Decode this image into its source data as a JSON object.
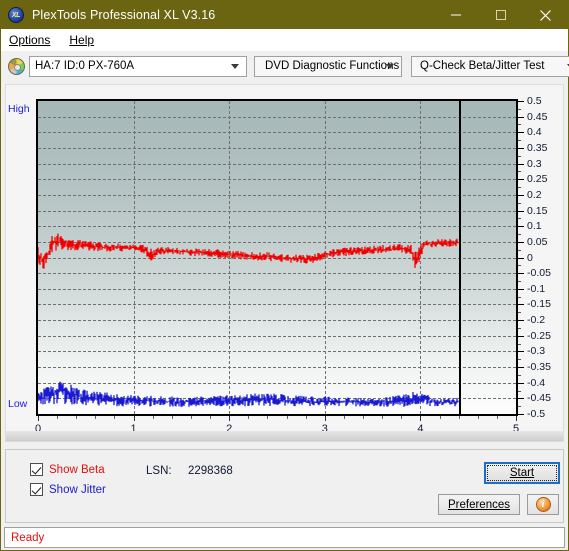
{
  "window": {
    "title": "PlexTools Professional XL V3.16",
    "icon": "xl-disc-icon",
    "icon_text": "XL",
    "minimize_label": "–",
    "maximize_label": "□",
    "close_label": "✕"
  },
  "menubar": {
    "items": [
      {
        "label": "Options",
        "mnemonic": "O"
      },
      {
        "label": "Help",
        "mnemonic": "H"
      }
    ]
  },
  "toolbar": {
    "drive_icon": "disc-icon",
    "drive_select": "HA:7 ID:0  PX-760A",
    "function_select": "DVD Diagnostic Functions",
    "test_select": "Q-Check Beta/Jitter Test"
  },
  "chart_panel": {
    "high_label": "High",
    "low_label": "Low"
  },
  "controls": {
    "show_beta_label": "Show Beta",
    "show_beta_mnemonic": "B",
    "show_beta_checked": true,
    "show_jitter_label": "Show Jitter",
    "show_jitter_mnemonic": "J",
    "show_jitter_checked": true,
    "lsn_label": "LSN:",
    "lsn_value": "2298368",
    "start_label": "Start",
    "start_mnemonic": "S",
    "preferences_label": "Preferences",
    "preferences_mnemonic": "P",
    "info_label": "i"
  },
  "statusbar": {
    "text": "Ready"
  },
  "colors": {
    "titlebar": "#6b6410",
    "beta_trace": "#f00000",
    "jitter_trace": "#1a1ad0",
    "axis_text": "#111a33",
    "status_text": "#e01010",
    "accent_focus": "#1e6ec8"
  },
  "chart_data": {
    "type": "line",
    "title": "Q-Check Beta/Jitter Test",
    "xlabel": "",
    "ylabel": "",
    "xlim": [
      0,
      5
    ],
    "ylim": [
      -0.5,
      0.5
    ],
    "grid": true,
    "legend": "checkbox-toggles",
    "x_ticks": [
      0,
      1,
      2,
      3,
      4,
      5
    ],
    "x_tick_labels": [
      "0",
      "1",
      "2",
      "3",
      "4",
      "5"
    ],
    "y_ticks": [
      0.5,
      0.45,
      0.4,
      0.35,
      0.3,
      0.25,
      0.2,
      0.15,
      0.1,
      0.05,
      0,
      -0.05,
      -0.1,
      -0.15,
      -0.2,
      -0.25,
      -0.3,
      -0.35,
      -0.4,
      -0.45,
      -0.5
    ],
    "y_tick_labels": [
      "0.5",
      "0.45",
      "0.4",
      "0.35",
      "0.3",
      "0.25",
      "0.2",
      "0.15",
      "0.1",
      "0.05",
      "0",
      "-0.05",
      "-0.1",
      "-0.15",
      "-0.2",
      "-0.25",
      "-0.3",
      "-0.35",
      "-0.4",
      "-0.45",
      "-0.5"
    ],
    "data_end_x": 4.4,
    "annotations": [
      {
        "type": "vline",
        "x": 4.4,
        "style": "solid-black",
        "label": "end-of-data marker"
      },
      {
        "type": "axis-text",
        "position": "top-left",
        "text": "High"
      },
      {
        "type": "axis-text",
        "position": "bottom-left",
        "text": "Low"
      }
    ],
    "series": [
      {
        "name": "Beta",
        "color": "#f00000",
        "band": true,
        "x": [
          0.0,
          0.05,
          0.1,
          0.15,
          0.2,
          0.25,
          0.3,
          0.35,
          0.4,
          0.45,
          0.5,
          0.6,
          0.7,
          0.8,
          0.9,
          1.0,
          1.1,
          1.2,
          1.25,
          1.3,
          1.4,
          1.5,
          1.6,
          1.7,
          1.8,
          1.9,
          2.0,
          2.1,
          2.2,
          2.3,
          2.4,
          2.5,
          2.6,
          2.7,
          2.8,
          2.9,
          3.0,
          3.1,
          3.2,
          3.3,
          3.4,
          3.5,
          3.6,
          3.7,
          3.8,
          3.9,
          3.95,
          4.0,
          4.05,
          4.1,
          4.2,
          4.3,
          4.4
        ],
        "y_center": [
          0.01,
          -0.01,
          0.005,
          0.045,
          0.05,
          0.048,
          0.046,
          0.044,
          0.042,
          0.04,
          0.038,
          0.035,
          0.033,
          0.032,
          0.031,
          0.03,
          0.028,
          0.005,
          0.022,
          0.022,
          0.021,
          0.02,
          0.018,
          0.016,
          0.014,
          0.012,
          0.01,
          0.008,
          0.006,
          0.004,
          0.002,
          0.0,
          -0.002,
          -0.004,
          -0.006,
          -0.002,
          0.01,
          0.014,
          0.018,
          0.02,
          0.022,
          0.024,
          0.026,
          0.028,
          0.028,
          0.026,
          -0.01,
          0.02,
          0.042,
          0.044,
          0.046,
          0.047,
          0.048
        ],
        "y_spread": [
          0.022,
          0.03,
          0.026,
          0.028,
          0.026,
          0.024,
          0.022,
          0.02,
          0.018,
          0.016,
          0.015,
          0.014,
          0.013,
          0.013,
          0.012,
          0.012,
          0.012,
          0.022,
          0.012,
          0.012,
          0.012,
          0.012,
          0.012,
          0.012,
          0.013,
          0.013,
          0.013,
          0.013,
          0.013,
          0.013,
          0.014,
          0.014,
          0.014,
          0.014,
          0.014,
          0.014,
          0.013,
          0.013,
          0.013,
          0.013,
          0.013,
          0.013,
          0.013,
          0.013,
          0.014,
          0.018,
          0.03,
          0.026,
          0.016,
          0.013,
          0.012,
          0.012,
          0.012
        ],
        "mean": 0.025,
        "units": "beta"
      },
      {
        "name": "Jitter",
        "color": "#1a1ad0",
        "band": true,
        "x": [
          0.0,
          0.05,
          0.1,
          0.15,
          0.2,
          0.25,
          0.3,
          0.35,
          0.4,
          0.45,
          0.5,
          0.6,
          0.7,
          0.8,
          0.9,
          1.0,
          1.1,
          1.2,
          1.3,
          1.4,
          1.5,
          1.6,
          1.7,
          1.8,
          1.9,
          2.0,
          2.1,
          2.2,
          2.3,
          2.4,
          2.5,
          2.6,
          2.7,
          2.8,
          2.9,
          3.0,
          3.1,
          3.2,
          3.3,
          3.4,
          3.5,
          3.6,
          3.7,
          3.8,
          3.9,
          4.0,
          4.05,
          4.1,
          4.2,
          4.3,
          4.4
        ],
        "y_center": [
          -0.455,
          -0.448,
          -0.44,
          -0.436,
          -0.43,
          -0.426,
          -0.43,
          -0.436,
          -0.44,
          -0.444,
          -0.448,
          -0.45,
          -0.452,
          -0.454,
          -0.456,
          -0.458,
          -0.458,
          -0.459,
          -0.46,
          -0.46,
          -0.461,
          -0.461,
          -0.46,
          -0.459,
          -0.458,
          -0.457,
          -0.456,
          -0.456,
          -0.455,
          -0.454,
          -0.455,
          -0.456,
          -0.458,
          -0.459,
          -0.46,
          -0.46,
          -0.46,
          -0.461,
          -0.461,
          -0.462,
          -0.462,
          -0.461,
          -0.46,
          -0.458,
          -0.452,
          -0.456,
          -0.45,
          -0.458,
          -0.461,
          -0.462,
          -0.462
        ],
        "y_spread": [
          0.022,
          0.026,
          0.03,
          0.034,
          0.038,
          0.04,
          0.036,
          0.032,
          0.028,
          0.026,
          0.024,
          0.022,
          0.021,
          0.02,
          0.019,
          0.018,
          0.017,
          0.017,
          0.016,
          0.016,
          0.016,
          0.016,
          0.016,
          0.017,
          0.018,
          0.018,
          0.018,
          0.019,
          0.02,
          0.02,
          0.019,
          0.018,
          0.017,
          0.016,
          0.015,
          0.015,
          0.014,
          0.014,
          0.014,
          0.014,
          0.014,
          0.015,
          0.016,
          0.018,
          0.024,
          0.018,
          0.022,
          0.016,
          0.014,
          0.013,
          0.013
        ],
        "mean": -0.456,
        "units": "jitter"
      }
    ]
  }
}
